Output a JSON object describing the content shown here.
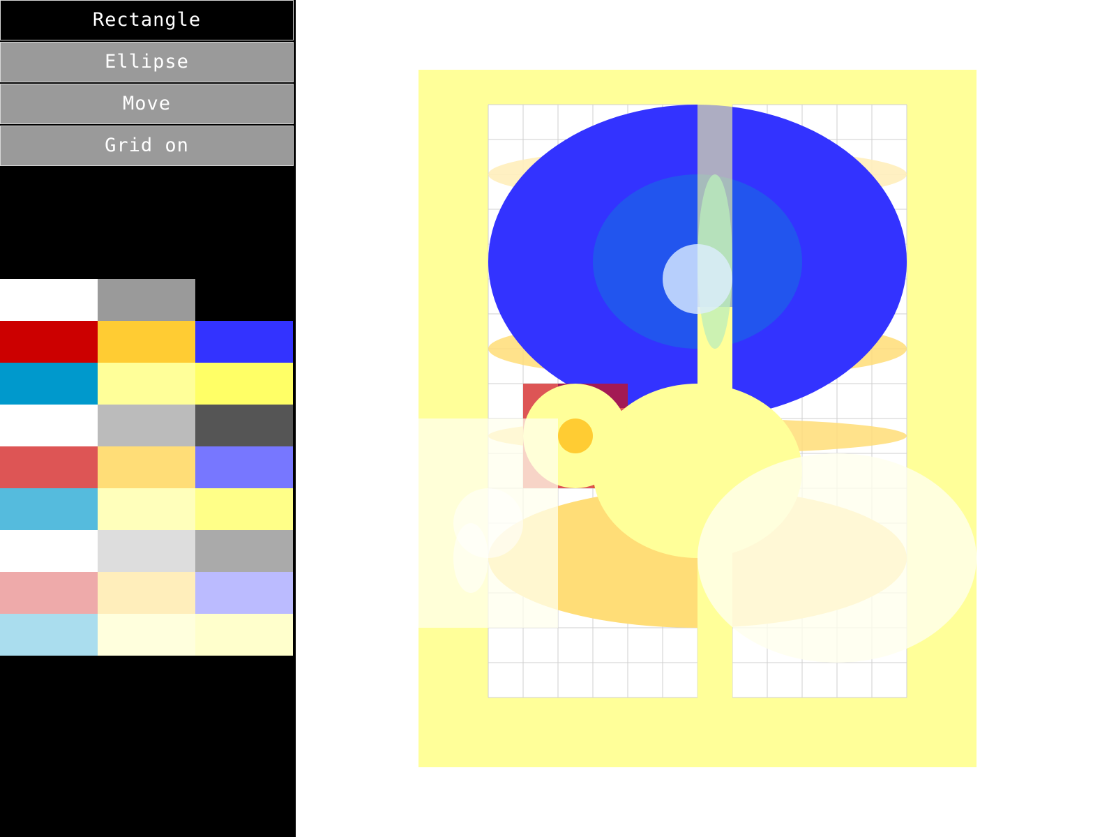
{
  "toolbar": {
    "tools": [
      {
        "label": "Rectangle",
        "active": true
      },
      {
        "label": "Ellipse",
        "active": false
      },
      {
        "label": "Move",
        "active": false
      },
      {
        "label": "Grid on",
        "active": false
      }
    ]
  },
  "palette": {
    "rows": [
      [
        "#ffffff",
        "#9a9a9a",
        null
      ],
      [
        "#cc0000",
        "#ffcc33",
        "#3333ff"
      ],
      [
        "#0099cc",
        "#ffff99",
        "#ffff66"
      ],
      [
        "#ffffff",
        "#bbbbbb",
        "#555555"
      ],
      [
        "#dd5555",
        "#ffdd77",
        "#7777ff"
      ],
      [
        "#55bbdd",
        "#ffffbb",
        "#ffff88"
      ],
      [
        "#ffffff",
        "#dddddd",
        "#aaaaaa"
      ],
      [
        "#eeaaaa",
        "#ffeebb",
        "#bbbbff"
      ],
      [
        "#aaddee",
        "#ffffdd",
        "#ffffcc"
      ]
    ]
  },
  "canvas": {
    "background_color": "#ffff99",
    "grid_color": "#cccccc",
    "panel_color": "#ffffff"
  }
}
